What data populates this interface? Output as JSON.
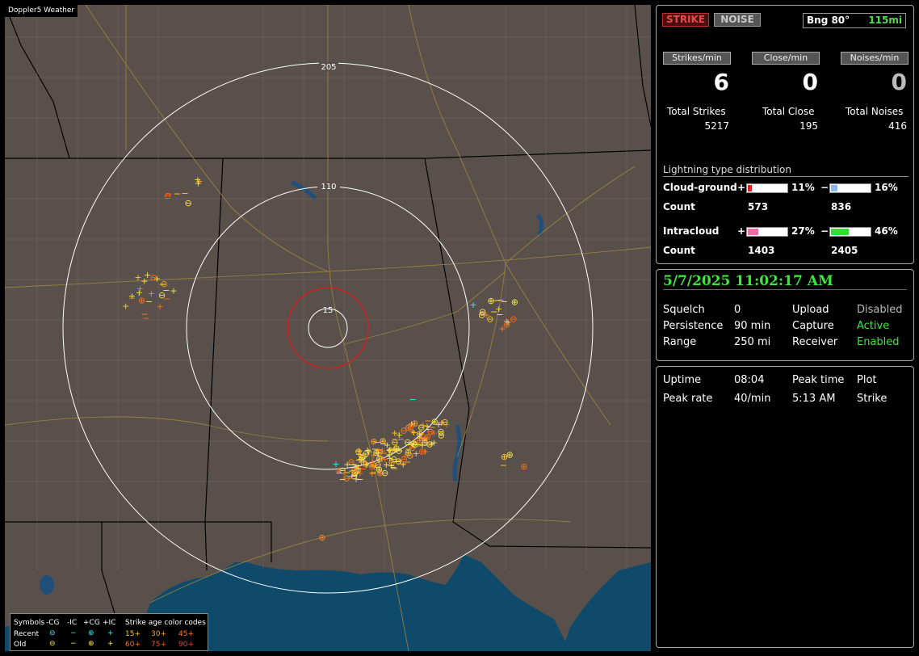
{
  "map": {
    "title": "Doppler5 Weather",
    "rings": [
      {
        "label": "15"
      },
      {
        "label": "110"
      },
      {
        "label": "205"
      }
    ]
  },
  "legend": {
    "symbols_label": "Symbols",
    "cols": [
      "-CG",
      "-IC",
      "+CG",
      "+IC"
    ],
    "recent_label": "Recent",
    "old_label": "Old",
    "recent_symbols": [
      "⊖",
      "−",
      "⊕",
      "+"
    ],
    "old_symbols": [
      "⊖",
      "−",
      "⊕",
      "+"
    ],
    "age_title": "Strike age color codes",
    "ages_row1": [
      "15+",
      "30+",
      "45+"
    ],
    "ages_row2": [
      "60+",
      "75+",
      "90+"
    ]
  },
  "stats": {
    "strike_btn": "STRIKE",
    "noise_btn": "NOISE",
    "bearing": "Bng 80°",
    "distance": "115mi",
    "strikes_min_label": "Strikes/min",
    "close_min_label": "Close/min",
    "noises_min_label": "Noises/min",
    "strikes_min": "6",
    "close_min": "0",
    "noises_min": "0",
    "total_strikes_label": "Total Strikes",
    "total_close_label": "Total Close",
    "total_noises_label": "Total Noises",
    "total_strikes": "5217",
    "total_close": "195",
    "total_noises": "416"
  },
  "distribution": {
    "title": "Lightning type distribution",
    "cg_label": "Cloud-ground",
    "ic_label": "Intracloud",
    "count_label": "Count",
    "plus": "+",
    "minus": "−",
    "cg_pos_pct": 11,
    "cg_neg_pct": 16,
    "ic_pos_pct": 27,
    "ic_neg_pct": 46,
    "cg_pos_pct_text": "11%",
    "cg_neg_pct_text": "16%",
    "ic_pos_pct_text": "27%",
    "ic_neg_pct_text": "46%",
    "cg_pos_count": "573",
    "cg_neg_count": "836",
    "ic_pos_count": "1403",
    "ic_neg_count": "2405",
    "colors": {
      "cg_pos": "#e02020",
      "cg_neg": "#8ab8e8",
      "ic_pos": "#f06aa8",
      "ic_neg": "#30e030"
    }
  },
  "status": {
    "datetime": "5/7/2025 11:02:17 AM",
    "squelch_label": "Squelch",
    "squelch": "0",
    "persistence_label": "Persistence",
    "persistence": "90 min",
    "range_label": "Range",
    "range": "250 mi",
    "upload_label": "Upload",
    "upload": "Disabled",
    "capture_label": "Capture",
    "capture": "Active",
    "receiver_label": "Receiver",
    "receiver": "Enabled"
  },
  "uptime": {
    "uptime_label": "Uptime",
    "uptime": "08:04",
    "peak_time_label": "Peak time",
    "peak_time": "5:13 AM",
    "plot_label": "Plot",
    "plot": "Strike",
    "peak_rate_label": "Peak rate",
    "peak_rate": "40/min"
  }
}
